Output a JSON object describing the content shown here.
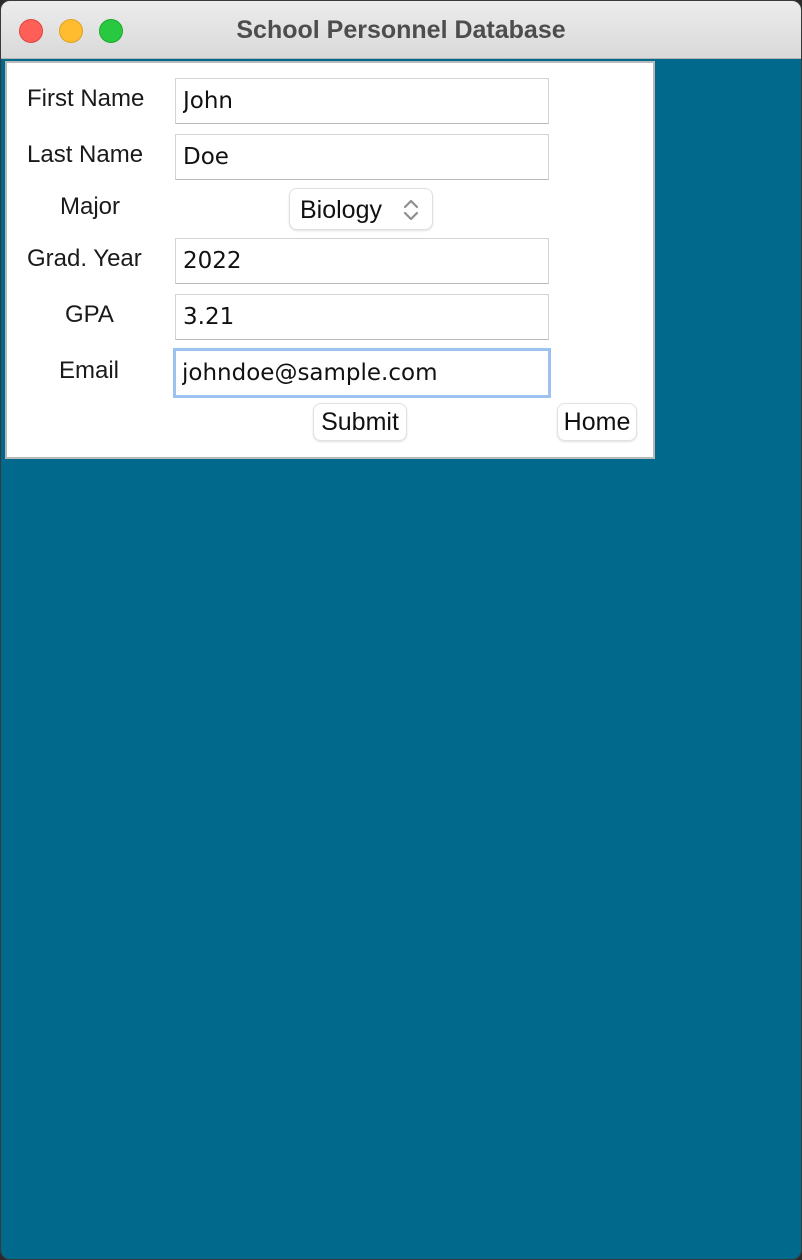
{
  "window": {
    "title": "School Personnel Database"
  },
  "form": {
    "first_name": {
      "label": "First Name",
      "value": "John"
    },
    "last_name": {
      "label": "Last Name",
      "value": "Doe"
    },
    "major": {
      "label": "Major",
      "selected": "Biology"
    },
    "grad_year": {
      "label": "Grad. Year",
      "value": "2022"
    },
    "gpa": {
      "label": "GPA",
      "value": "3.21"
    },
    "email": {
      "label": "Email",
      "value": "johndoe@sample.com"
    }
  },
  "buttons": {
    "submit": "Submit",
    "home": "Home"
  },
  "colors": {
    "background": "#00698c",
    "close": "#fe5f57",
    "minimize": "#febc2e",
    "zoom": "#28c840",
    "focus_ring": "#9cc3ef"
  },
  "icons": {
    "select_indicator": "up-down-chevron-icon"
  }
}
